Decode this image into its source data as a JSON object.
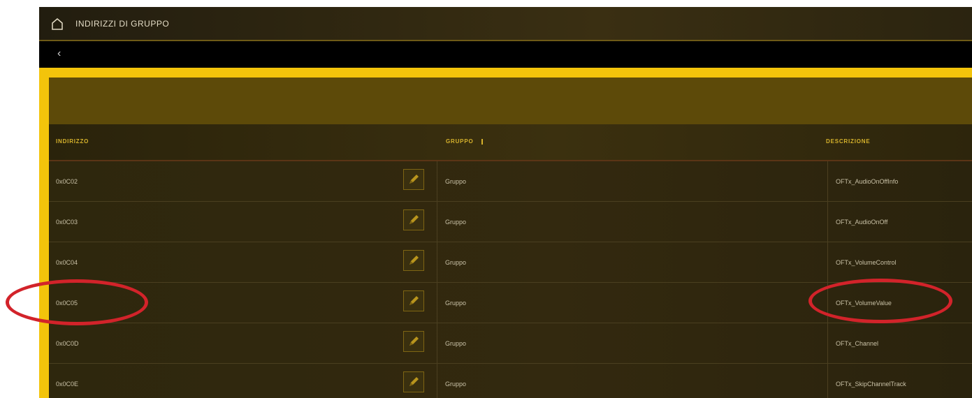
{
  "window": {
    "title": "INDIRIZZI DI GRUPPO"
  },
  "icons": {
    "home": "home-icon",
    "back": "back-arrow-icon",
    "edit": "pencil-icon",
    "sort": "sort-icon"
  },
  "nav": {
    "back_glyph": "‹"
  },
  "table": {
    "headers": {
      "address": "INDIRIZZO",
      "group": "GRUPPO",
      "description": "DESCRIZIONE"
    },
    "rows": [
      {
        "address": "0x0C02",
        "group": "Gruppo",
        "description": "OFTx_AudioOnOffInfo"
      },
      {
        "address": "0x0C03",
        "group": "Gruppo",
        "description": "OFTx_AudioOnOff"
      },
      {
        "address": "0x0C04",
        "group": "Gruppo",
        "description": "OFTx_VolumeControl"
      },
      {
        "address": "0x0C05",
        "group": "Gruppo",
        "description": "OFTx_VolumeValue"
      },
      {
        "address": "0x0C0D",
        "group": "Gruppo",
        "description": "OFTx_Channel"
      },
      {
        "address": "0x0C0E",
        "group": "Gruppo",
        "description": "OFTx_SkipChannelTrack"
      }
    ]
  },
  "colors": {
    "accent_yellow": "#f3c40b",
    "header_text": "#d6b22c",
    "annotation_red": "#d2232a"
  }
}
